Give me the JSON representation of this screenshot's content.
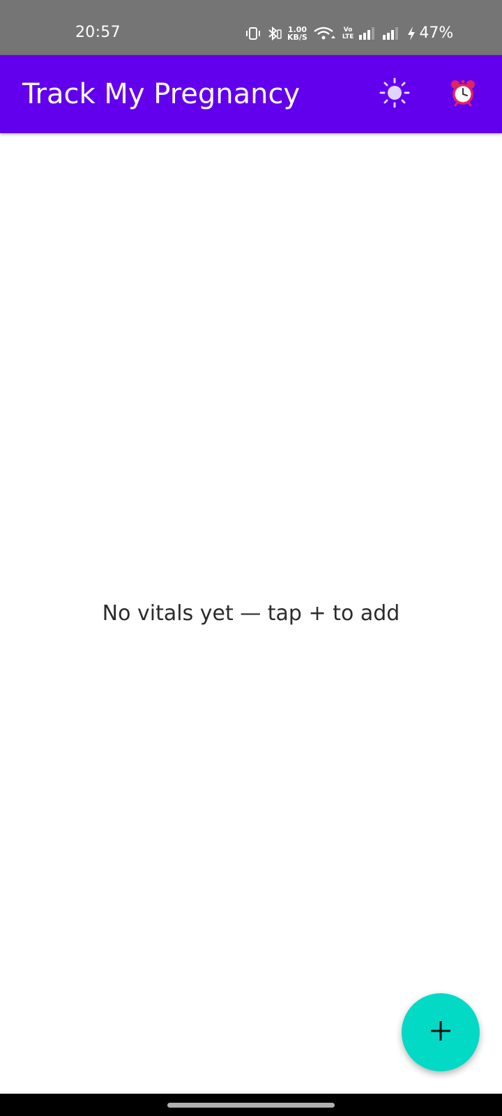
{
  "status_bar": {
    "time": "20:57",
    "net_speed_value": "1.00",
    "net_speed_unit": "KB/S",
    "volte_top": "Vo",
    "volte_bottom": "LTE",
    "battery": "47%",
    "icons": [
      "vibrate-icon",
      "bluetooth-icon",
      "wifi-icon",
      "signal-icon",
      "signal-icon",
      "charging-icon"
    ]
  },
  "app_bar": {
    "title": "Track My Pregnancy",
    "actions": [
      "theme-toggle-icon",
      "alarm-clock-icon"
    ]
  },
  "main": {
    "empty_message": "No vitals yet — tap + to add"
  },
  "fab": {
    "icon": "plus-icon"
  },
  "colors": {
    "status_bar": "#757575",
    "app_bar": "#6200ee",
    "fab": "#03dac5",
    "nav_bar": "#000000",
    "sun_icon": "#e1d4ff",
    "alarm_icon": "#e0245e"
  }
}
